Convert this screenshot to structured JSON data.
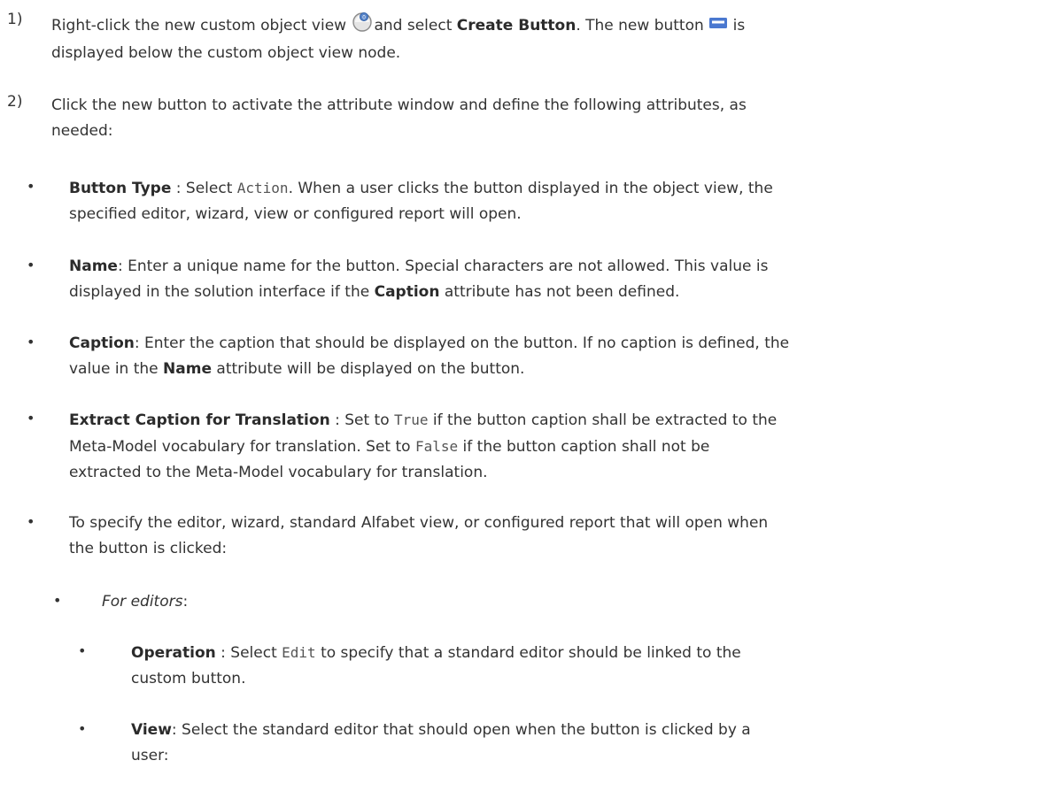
{
  "steps": [
    {
      "num": "1)",
      "t1": "Right-click the new custom object view ",
      "t2": "and select ",
      "b1": "Create Button",
      "t3": ". The new button ",
      "t4": " is",
      "t5": "displayed below the custom object view node.",
      "icon_view": "custom-object-view-icon",
      "icon_button": "button-icon"
    },
    {
      "num": "2)",
      "t1": "Click the new button to activate the attribute window and define the following attributes, as",
      "t2": "needed:"
    }
  ],
  "items": {
    "button_type": {
      "label": "Button Type",
      "t1": " : Select ",
      "code": "Action",
      "t2": ". When a user clicks the button displayed in the object view, the",
      "t3": "specified editor, wizard, view or configured report will open."
    },
    "name": {
      "label": "Name",
      "t1": ": Enter a unique name for the button. Special characters are not allowed. This value is",
      "t2": "displayed in the solution interface if the ",
      "b2": "Caption",
      "t3": " attribute has not been defined."
    },
    "caption": {
      "label": "Caption",
      "t1": ": Enter the caption that should be displayed on the button. If no caption is defined, the",
      "t2": "value in the ",
      "b2": "Name",
      "t3": " attribute will be displayed on the button."
    },
    "extract": {
      "label": "Extract Caption for Translation",
      "t1": " : Set to ",
      "code1": "True",
      "t2": " if the button caption shall be extracted to the",
      "t3": "Meta-Model vocabulary for translation. Set to ",
      "code2": "False",
      "t4": " if the button caption shall not be",
      "t5": "extracted to the Meta-Model vocabulary for translation."
    },
    "specify": {
      "t1": "To specify the editor, wizard, standard Alfabet view, or configured report that will open when",
      "t2": "the button is clicked:"
    },
    "for_editors": {
      "em": "For editors",
      "t1": ":"
    },
    "operation": {
      "label": "Operation",
      "t1": " : Select ",
      "code": "Edit",
      "t2": " to specify that a standard editor should be linked to the",
      "t3": "custom button."
    },
    "view": {
      "label": "View",
      "t1": ": Select the standard editor that should open when the button is clicked by a",
      "t2": "user:"
    }
  },
  "bullet_char": "•"
}
